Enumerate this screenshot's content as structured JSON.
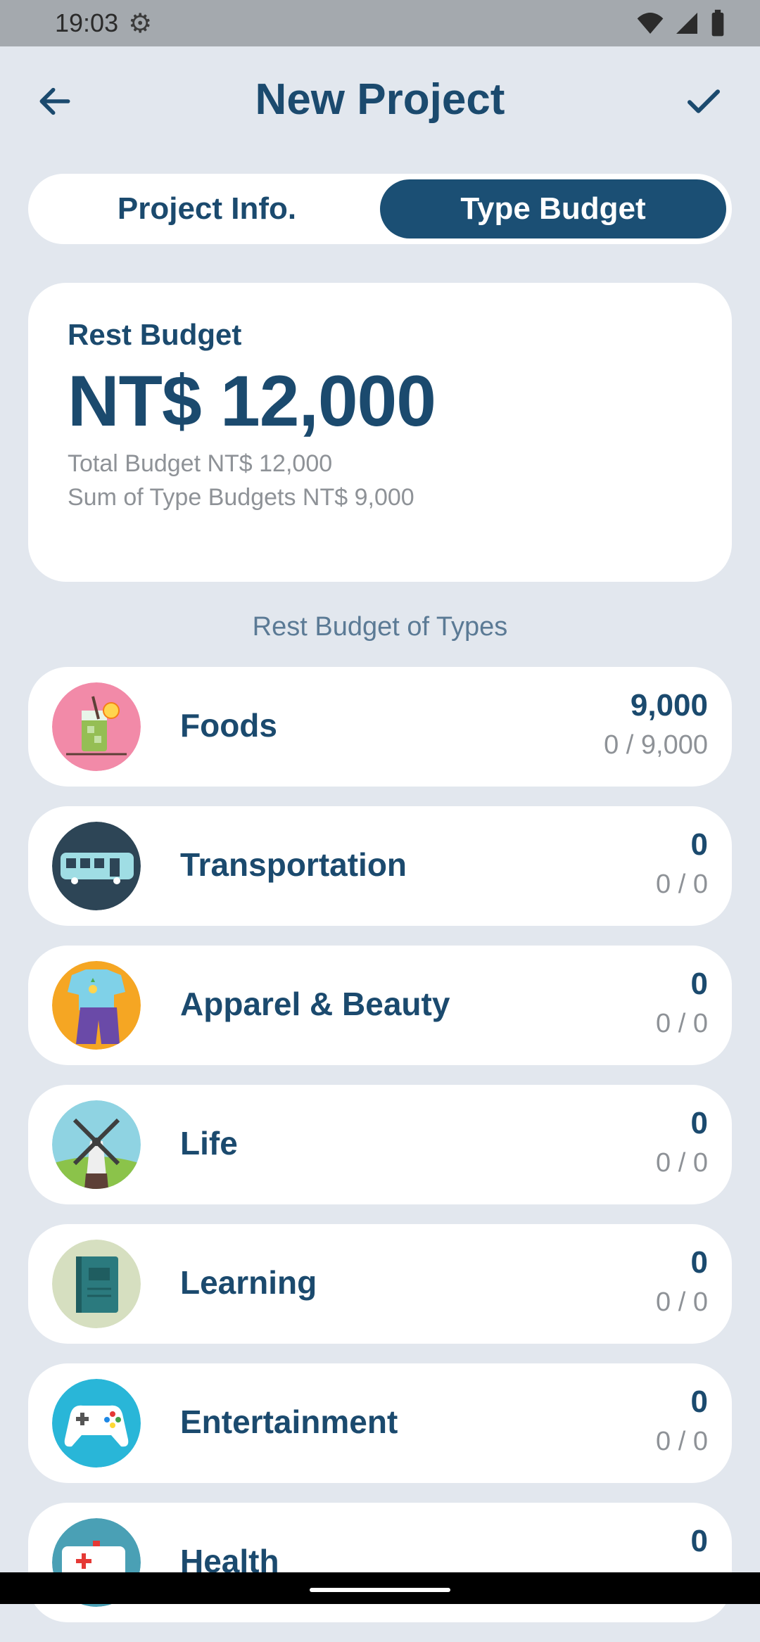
{
  "status_bar": {
    "time": "19:03"
  },
  "header": {
    "title": "New Project"
  },
  "tabs": [
    {
      "label": "Project Info.",
      "active": false
    },
    {
      "label": "Type Budget",
      "active": true
    }
  ],
  "budget": {
    "label": "Rest Budget",
    "amount": "NT$ 12,000",
    "total": "Total Budget NT$ 12,000",
    "sum": "Sum of Type Budgets NT$ 9,000"
  },
  "section_title": "Rest Budget of Types",
  "types": [
    {
      "name": "Foods",
      "value": "9,000",
      "ratio": "0 / 9,000",
      "icon": "drink-icon"
    },
    {
      "name": "Transportation",
      "value": "0",
      "ratio": "0 / 0",
      "icon": "bus-icon"
    },
    {
      "name": "Apparel & Beauty",
      "value": "0",
      "ratio": "0 / 0",
      "icon": "clothes-icon"
    },
    {
      "name": "Life",
      "value": "0",
      "ratio": "0 / 0",
      "icon": "windmill-icon"
    },
    {
      "name": "Learning",
      "value": "0",
      "ratio": "0 / 0",
      "icon": "book-icon"
    },
    {
      "name": "Entertainment",
      "value": "0",
      "ratio": "0 / 0",
      "icon": "gamepad-icon"
    },
    {
      "name": "Health",
      "value": "0",
      "ratio": "",
      "icon": "ambulance-icon"
    }
  ],
  "colors": {
    "primary": "#1b4a6e",
    "background": "#e2e7ee",
    "active_tab": "#1b4f74"
  }
}
